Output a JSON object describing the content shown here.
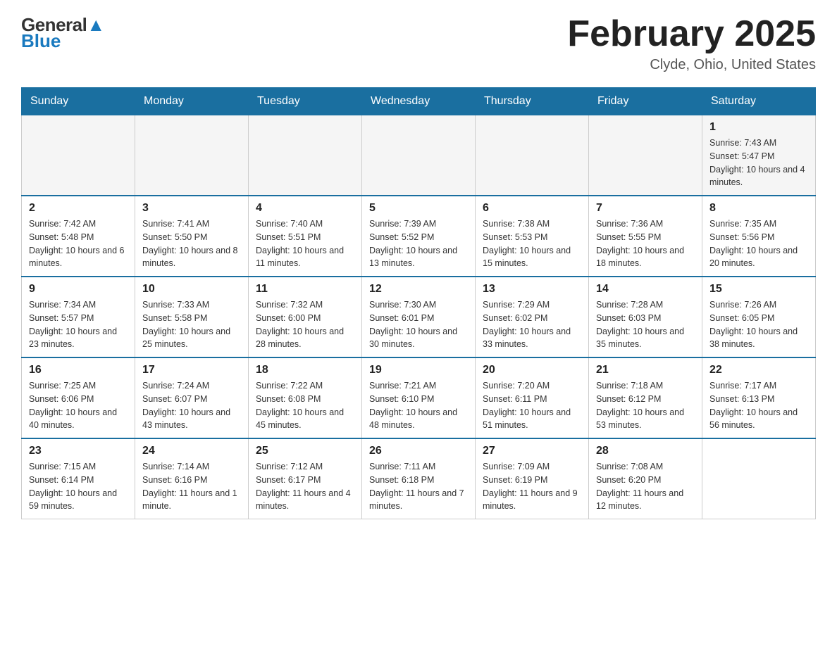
{
  "header": {
    "logo_general": "General",
    "logo_blue": "Blue",
    "month_title": "February 2025",
    "location": "Clyde, Ohio, United States"
  },
  "days_of_week": [
    "Sunday",
    "Monday",
    "Tuesday",
    "Wednesday",
    "Thursday",
    "Friday",
    "Saturday"
  ],
  "weeks": [
    [
      {
        "day": "",
        "info": ""
      },
      {
        "day": "",
        "info": ""
      },
      {
        "day": "",
        "info": ""
      },
      {
        "day": "",
        "info": ""
      },
      {
        "day": "",
        "info": ""
      },
      {
        "day": "",
        "info": ""
      },
      {
        "day": "1",
        "info": "Sunrise: 7:43 AM\nSunset: 5:47 PM\nDaylight: 10 hours and 4 minutes."
      }
    ],
    [
      {
        "day": "2",
        "info": "Sunrise: 7:42 AM\nSunset: 5:48 PM\nDaylight: 10 hours and 6 minutes."
      },
      {
        "day": "3",
        "info": "Sunrise: 7:41 AM\nSunset: 5:50 PM\nDaylight: 10 hours and 8 minutes."
      },
      {
        "day": "4",
        "info": "Sunrise: 7:40 AM\nSunset: 5:51 PM\nDaylight: 10 hours and 11 minutes."
      },
      {
        "day": "5",
        "info": "Sunrise: 7:39 AM\nSunset: 5:52 PM\nDaylight: 10 hours and 13 minutes."
      },
      {
        "day": "6",
        "info": "Sunrise: 7:38 AM\nSunset: 5:53 PM\nDaylight: 10 hours and 15 minutes."
      },
      {
        "day": "7",
        "info": "Sunrise: 7:36 AM\nSunset: 5:55 PM\nDaylight: 10 hours and 18 minutes."
      },
      {
        "day": "8",
        "info": "Sunrise: 7:35 AM\nSunset: 5:56 PM\nDaylight: 10 hours and 20 minutes."
      }
    ],
    [
      {
        "day": "9",
        "info": "Sunrise: 7:34 AM\nSunset: 5:57 PM\nDaylight: 10 hours and 23 minutes."
      },
      {
        "day": "10",
        "info": "Sunrise: 7:33 AM\nSunset: 5:58 PM\nDaylight: 10 hours and 25 minutes."
      },
      {
        "day": "11",
        "info": "Sunrise: 7:32 AM\nSunset: 6:00 PM\nDaylight: 10 hours and 28 minutes."
      },
      {
        "day": "12",
        "info": "Sunrise: 7:30 AM\nSunset: 6:01 PM\nDaylight: 10 hours and 30 minutes."
      },
      {
        "day": "13",
        "info": "Sunrise: 7:29 AM\nSunset: 6:02 PM\nDaylight: 10 hours and 33 minutes."
      },
      {
        "day": "14",
        "info": "Sunrise: 7:28 AM\nSunset: 6:03 PM\nDaylight: 10 hours and 35 minutes."
      },
      {
        "day": "15",
        "info": "Sunrise: 7:26 AM\nSunset: 6:05 PM\nDaylight: 10 hours and 38 minutes."
      }
    ],
    [
      {
        "day": "16",
        "info": "Sunrise: 7:25 AM\nSunset: 6:06 PM\nDaylight: 10 hours and 40 minutes."
      },
      {
        "day": "17",
        "info": "Sunrise: 7:24 AM\nSunset: 6:07 PM\nDaylight: 10 hours and 43 minutes."
      },
      {
        "day": "18",
        "info": "Sunrise: 7:22 AM\nSunset: 6:08 PM\nDaylight: 10 hours and 45 minutes."
      },
      {
        "day": "19",
        "info": "Sunrise: 7:21 AM\nSunset: 6:10 PM\nDaylight: 10 hours and 48 minutes."
      },
      {
        "day": "20",
        "info": "Sunrise: 7:20 AM\nSunset: 6:11 PM\nDaylight: 10 hours and 51 minutes."
      },
      {
        "day": "21",
        "info": "Sunrise: 7:18 AM\nSunset: 6:12 PM\nDaylight: 10 hours and 53 minutes."
      },
      {
        "day": "22",
        "info": "Sunrise: 7:17 AM\nSunset: 6:13 PM\nDaylight: 10 hours and 56 minutes."
      }
    ],
    [
      {
        "day": "23",
        "info": "Sunrise: 7:15 AM\nSunset: 6:14 PM\nDaylight: 10 hours and 59 minutes."
      },
      {
        "day": "24",
        "info": "Sunrise: 7:14 AM\nSunset: 6:16 PM\nDaylight: 11 hours and 1 minute."
      },
      {
        "day": "25",
        "info": "Sunrise: 7:12 AM\nSunset: 6:17 PM\nDaylight: 11 hours and 4 minutes."
      },
      {
        "day": "26",
        "info": "Sunrise: 7:11 AM\nSunset: 6:18 PM\nDaylight: 11 hours and 7 minutes."
      },
      {
        "day": "27",
        "info": "Sunrise: 7:09 AM\nSunset: 6:19 PM\nDaylight: 11 hours and 9 minutes."
      },
      {
        "day": "28",
        "info": "Sunrise: 7:08 AM\nSunset: 6:20 PM\nDaylight: 11 hours and 12 minutes."
      },
      {
        "day": "",
        "info": ""
      }
    ]
  ]
}
